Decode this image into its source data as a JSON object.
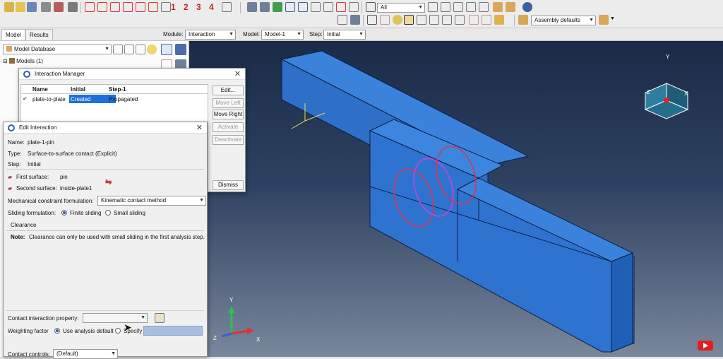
{
  "context_bar": {
    "module_label": "Module:",
    "module_value": "Interaction",
    "model_label": "Model:",
    "model_value": "Model-1",
    "step_label": "Step:",
    "step_value": "Initial"
  },
  "toolbar": {
    "selection_filter": "All",
    "render_style": "Assembly defaults",
    "view_numbers": [
      "1",
      "2",
      "3",
      "4"
    ]
  },
  "left_panel": {
    "tabs": [
      "Model",
      "Results"
    ],
    "database_select": "Model Database",
    "tree_root": "Models (1)"
  },
  "interaction_manager": {
    "title": "Interaction Manager",
    "columns": [
      "Name",
      "Initial",
      "Step-1"
    ],
    "rows": [
      {
        "name": "plate-to-plate",
        "initial": "Created",
        "step1": "Propagated"
      }
    ],
    "buttons": {
      "edit": "Edit...",
      "move_left": "Move Left",
      "move_right": "Move Right",
      "activate": "Activate",
      "deactivate": "Deactivate",
      "dismiss": "Dismiss"
    }
  },
  "edit_interaction": {
    "title": "Edit Interaction",
    "name_label": "Name:",
    "name_value": "plate-1-pin",
    "type_label": "Type:",
    "type_value": "Surface-to-surface contact (Explicit)",
    "step_label": "Step:",
    "step_value": "Initial",
    "first_surface_label": "First surface:",
    "first_surface_value": "pin",
    "second_surface_label": "Second surface:",
    "second_surface_value": "inside-plate1",
    "mech_label": "Mechanical constraint formulation:",
    "mech_value": "Kinematic contact method",
    "sliding_label": "Sliding formulation:",
    "sliding_finite": "Finite sliding",
    "sliding_small": "Small sliding",
    "clearance_tab": "Clearance",
    "note_label": "Note:",
    "note_text": "Clearance can only be used with small sliding in the first analysis step.",
    "contact_prop_label": "Contact interaction property:",
    "contact_prop_value": "",
    "weighting_label": "Weighting factor",
    "weighting_default": "Use analysis default",
    "weighting_specify": "Specify",
    "contact_controls_label": "Contact controls:",
    "contact_controls_value": "(Default)"
  },
  "triad_labels": {
    "x": "X",
    "y": "Y",
    "z": "Z"
  }
}
